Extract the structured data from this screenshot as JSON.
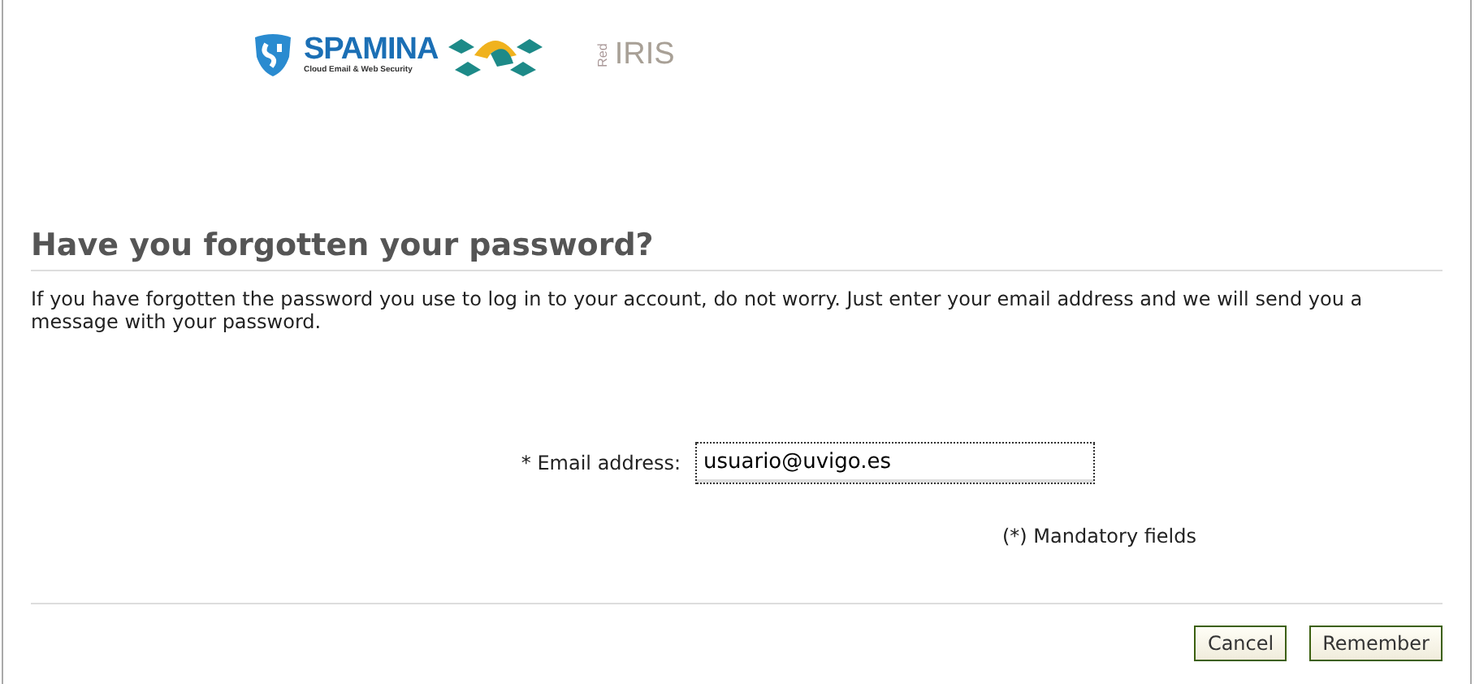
{
  "logos": {
    "spamina": {
      "name": "SPAMINA",
      "tagline": "Cloud Email & Web Security"
    },
    "rediris": {
      "prefix": "Red",
      "name": "IRIS"
    }
  },
  "heading": "Have you forgotten your password?",
  "intro": "If you have forgotten the password you use to log in to your account, do not worry. Just enter your email address and we will send you a message with your password.",
  "field": {
    "label": "* Email address:",
    "value": "usuario@uvigo.es",
    "focused": true
  },
  "note": "(*) Mandatory fields",
  "buttons": [
    "Cancel",
    "Remember"
  ]
}
